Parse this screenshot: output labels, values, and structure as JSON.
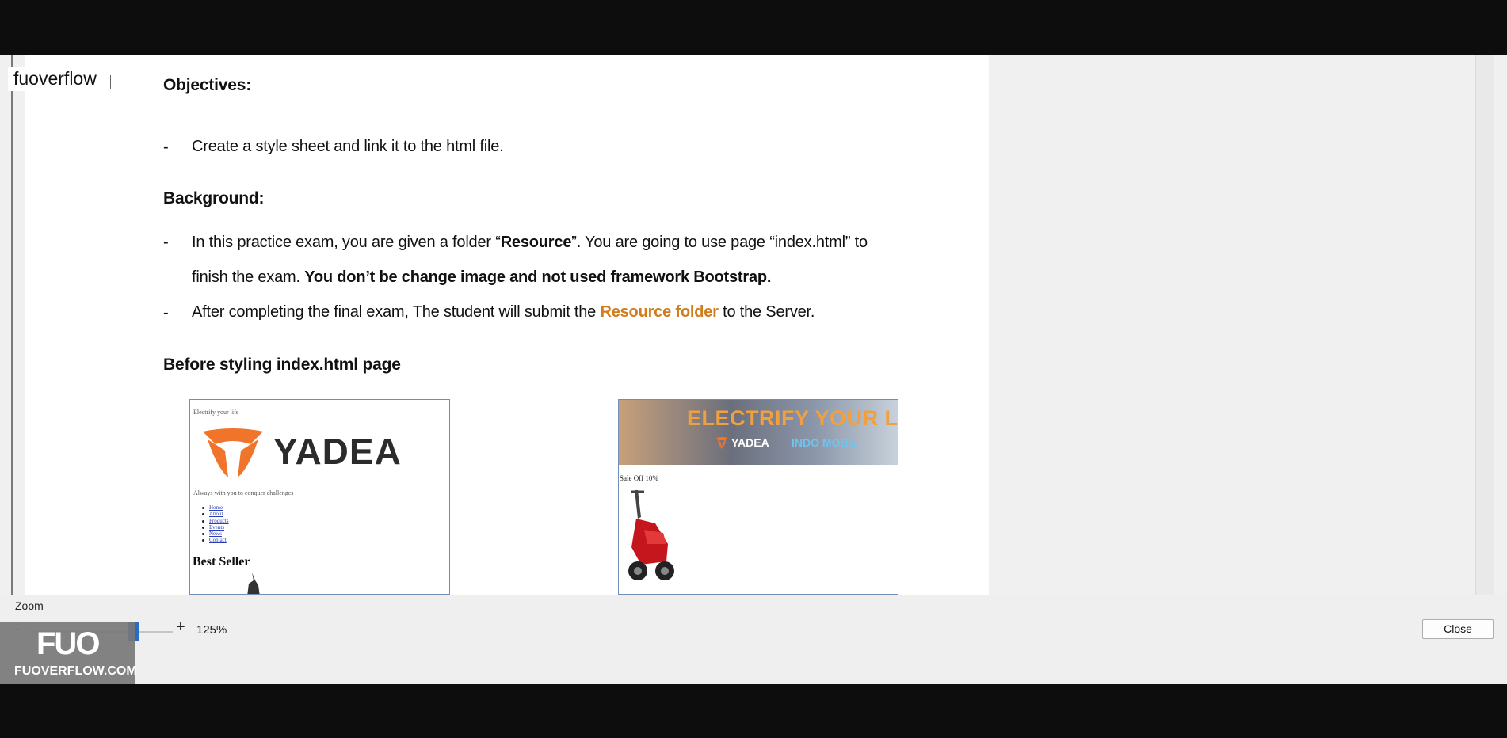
{
  "brand": {
    "name": "fuoverflow"
  },
  "document": {
    "objectives_heading": "Objectives:",
    "objectives_items": [
      "Create a style sheet and link it to the html file."
    ],
    "background_heading": "Background:",
    "bullet_dash": "-",
    "bg1_a": "In this practice exam, you are given a folder “",
    "bg1_b": "Resource",
    "bg1_c": "”. You are going to use page “index.html”  to",
    "bg1_d": "finish the exam. ",
    "bg1_e": "You don’t be change image and not used framework Bootstrap.",
    "bg2_a": "After completing the final exam, The student will submit the ",
    "bg2_b": "Resource folder",
    "bg2_c": " to the Server.",
    "before_heading": "Before styling index.html page",
    "shot_a": {
      "top_text": "Electrify your life",
      "logo": "YADEA",
      "tagline": "Always with you to conquer challenges",
      "links": [
        "Home",
        "About",
        "Products",
        "Events",
        "News",
        "Contact"
      ],
      "best": "Best Seller"
    },
    "shot_b": {
      "banner_title": "ELECTRIFY YOUR LIFE",
      "banner_brand": "YADEA",
      "banner_partner": "INDO MOBIL",
      "sale": "Sale Off 10%"
    },
    "orange_color": "#d27d1b"
  },
  "zoom": {
    "label": "Zoom",
    "minus": "-",
    "plus": "+",
    "value": "125%",
    "level_percent": 125
  },
  "buttons": {
    "close": "Close"
  },
  "watermark": {
    "logo": "FUO",
    "site": "FUOVERFLOW.COM"
  }
}
